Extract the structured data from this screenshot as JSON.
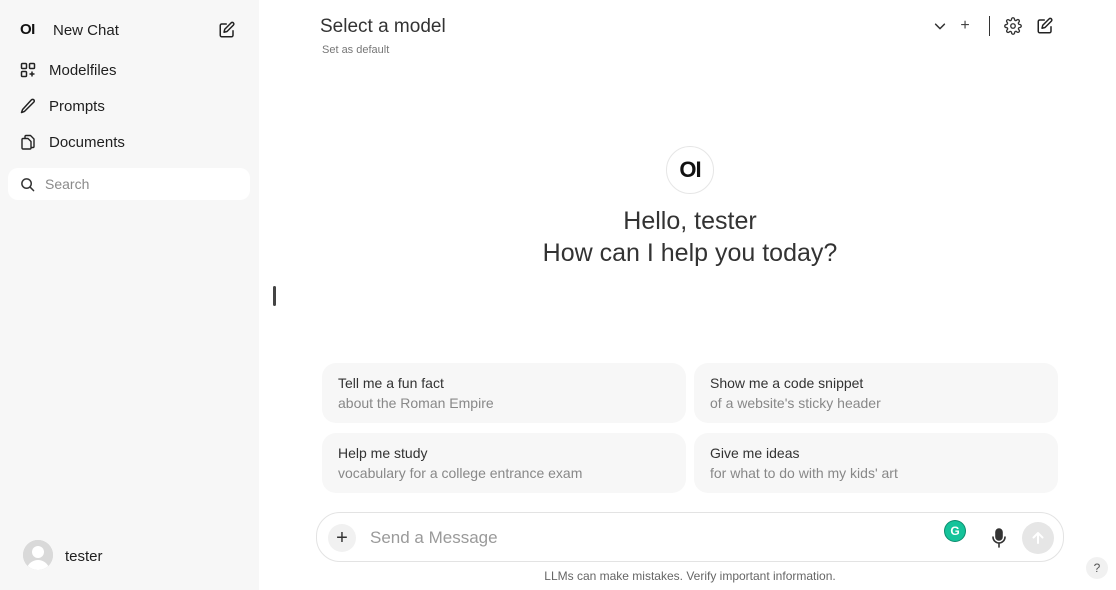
{
  "sidebar": {
    "logo_text": "OI",
    "new_chat_label": "New Chat",
    "items": [
      {
        "label": "Modelfiles",
        "icon": "grid-icon"
      },
      {
        "label": "Prompts",
        "icon": "pencil-icon"
      },
      {
        "label": "Documents",
        "icon": "documents-icon"
      }
    ],
    "search_placeholder": "Search",
    "user_name": "tester"
  },
  "header": {
    "model_title": "Select a model",
    "set_default": "Set as default",
    "add_label": "+"
  },
  "hero": {
    "logo_text": "OI",
    "greeting": "Hello, tester",
    "question": "How can I help you today?"
  },
  "suggestions": [
    {
      "title": "Tell me a fun fact",
      "subtitle": "about the Roman Empire"
    },
    {
      "title": "Show me a code snippet",
      "subtitle": "of a website's sticky header"
    },
    {
      "title": "Help me study",
      "subtitle": "vocabulary for a college entrance exam"
    },
    {
      "title": "Give me ideas",
      "subtitle": "for what to do with my kids' art"
    }
  ],
  "composer": {
    "plus_label": "+",
    "placeholder": "Send a Message",
    "grammarly_label": "G"
  },
  "footer": {
    "disclaimer": "LLMs can make mistakes. Verify important information.",
    "help_label": "?"
  },
  "colors": {
    "sidebar_bg": "#f7f7f7",
    "card_bg": "#f7f7f7",
    "grammarly": "#15c39a"
  }
}
